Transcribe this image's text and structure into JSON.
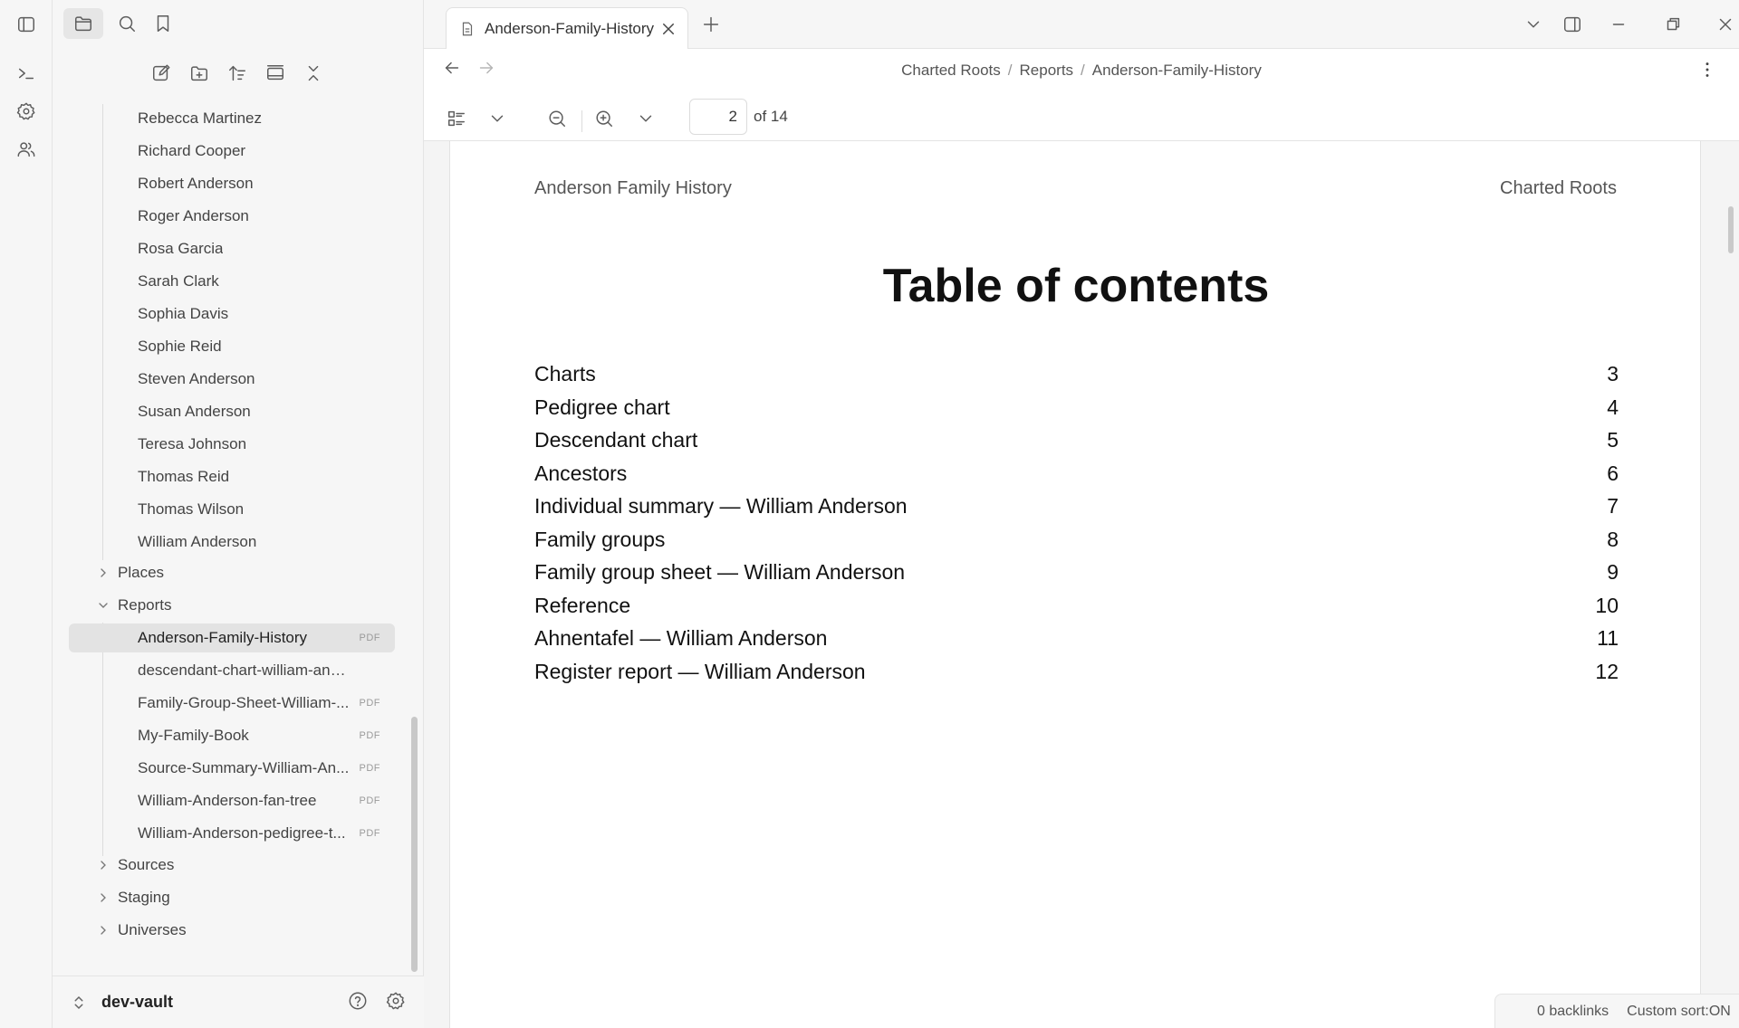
{
  "sidebar": {
    "people_items": [
      "Rebecca Martinez",
      "Richard Cooper",
      "Robert Anderson",
      "Roger Anderson",
      "Rosa Garcia",
      "Sarah Clark",
      "Sophia Davis",
      "Sophie Reid",
      "Steven Anderson",
      "Susan Anderson",
      "Teresa Johnson",
      "Thomas Reid",
      "Thomas Wilson",
      "William Anderson"
    ],
    "places_label": "Places",
    "reports_label": "Reports",
    "reports_items": [
      {
        "label": "Anderson-Family-History",
        "tag": "PDF"
      },
      {
        "label": "descendant-chart-william-anders...",
        "tag": ""
      },
      {
        "label": "Family-Group-Sheet-William-...",
        "tag": "PDF"
      },
      {
        "label": "My-Family-Book",
        "tag": "PDF"
      },
      {
        "label": "Source-Summary-William-An...",
        "tag": "PDF"
      },
      {
        "label": "William-Anderson-fan-tree",
        "tag": "PDF"
      },
      {
        "label": "William-Anderson-pedigree-t...",
        "tag": "PDF"
      }
    ],
    "bottom_folders": [
      "Sources",
      "Staging",
      "Universes"
    ],
    "vault_name": "dev-vault"
  },
  "tab": {
    "title": "Anderson-Family-History"
  },
  "breadcrumb": [
    "Charted Roots",
    "Reports",
    "Anderson-Family-History"
  ],
  "pdf_toolbar": {
    "page": "2",
    "total": "of 14"
  },
  "document": {
    "header_left": "Anderson Family History",
    "header_right": "Charted Roots",
    "title": "Table of contents",
    "toc": [
      {
        "title": "Charts",
        "page": "3"
      },
      {
        "title": "Pedigree chart",
        "page": "4"
      },
      {
        "title": "Descendant chart",
        "page": "5"
      },
      {
        "title": "Ancestors",
        "page": "6"
      },
      {
        "title": "Individual summary — William Anderson",
        "page": "7"
      },
      {
        "title": "Family groups",
        "page": "8"
      },
      {
        "title": "Family group sheet — William Anderson",
        "page": "9"
      },
      {
        "title": "Reference",
        "page": "10"
      },
      {
        "title": "Ahnentafel — William Anderson",
        "page": "11"
      },
      {
        "title": "Register report — William Anderson",
        "page": "12"
      }
    ]
  },
  "status": {
    "backlinks": "0 backlinks",
    "sort": "Custom sort:ON"
  },
  "icons": {
    "ribbon": [
      "terminal-icon",
      "settings-icon",
      "people-icon"
    ],
    "sidebar_tabs": [
      "sidebar-toggle-icon",
      "folder-icon",
      "search-icon",
      "bookmark-icon"
    ],
    "file_nav": [
      "new-note-icon",
      "new-folder-icon",
      "sort-icon",
      "collapse-view-icon",
      "collapse-all-icon"
    ]
  },
  "colors": {
    "sidebar_bg": "#f6f6f6",
    "active_item": "#e3e3e3",
    "page_bg": "#ffffff"
  }
}
